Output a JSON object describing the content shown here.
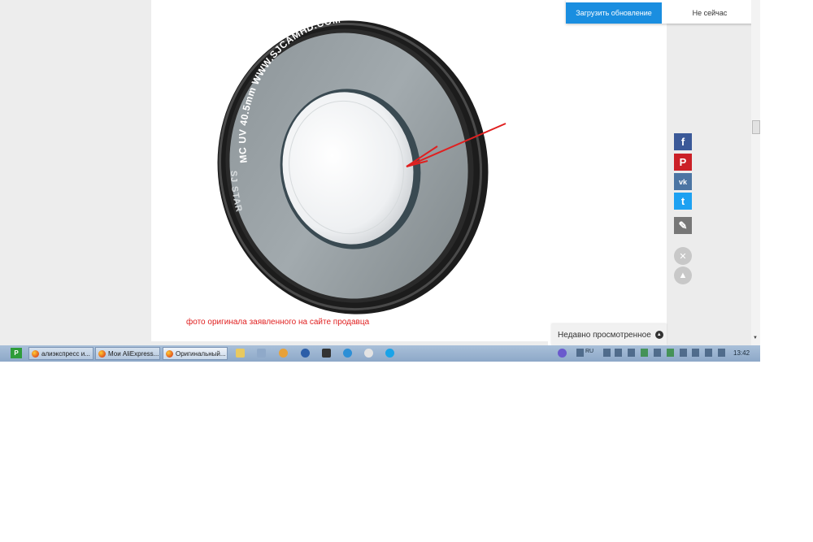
{
  "photo": {
    "ring_text_top": "MC UV 40.5mm WWW.SJCAMHD.COM",
    "ring_text_side": "SJ STAR",
    "caption": "фото оригинала заявленного на сайте продавца"
  },
  "update_bar": {
    "update_label": "Загрузить обновление",
    "later_label": "Не сейчас"
  },
  "share": {
    "facebook_glyph": "f",
    "pinterest_glyph": "P",
    "vk_glyph": "vk",
    "twitter_glyph": "t",
    "edit_glyph": "✎"
  },
  "recent": {
    "label": "Недавно просмотренное"
  },
  "taskbar": {
    "tasks": [
      {
        "label": "алиэкспресс и..."
      },
      {
        "label": "Мои AliExpress..."
      },
      {
        "label": "Оригинальный..."
      }
    ],
    "language": "RU",
    "clock": "13:42"
  },
  "colors": {
    "accent": "#1a8ee0",
    "caption": "#e02020",
    "arrow": "#e02020"
  }
}
